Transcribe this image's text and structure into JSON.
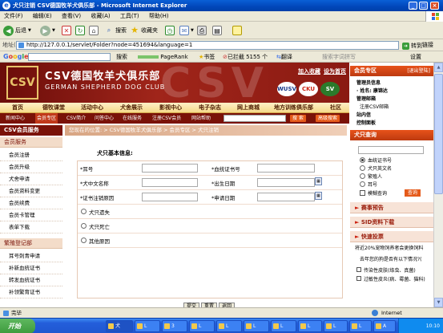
{
  "window": {
    "title": "犬只注销 CSV德国牧羊犬俱乐部 - Microsoft Internet Explorer"
  },
  "menu": [
    "文件(F)",
    "编辑(E)",
    "查看(V)",
    "收藏(A)",
    "工具(T)",
    "帮助(H)"
  ],
  "toolbar": {
    "back": "后退",
    "search": "搜索",
    "favorites": "收藏夹"
  },
  "address": {
    "label": "地址(D)",
    "url": "http://127.0.0.1/servlet/Folder?node=451694&language=1",
    "go": "转到",
    "links": "链接"
  },
  "google_bar": {
    "logo": "Google",
    "search": "搜索",
    "pagerank": "PageRank",
    "bookmarks": "书签",
    "blocked": "已拦截 5155 个",
    "translate": "翻译",
    "find_placeholder": "搜索字词拼写",
    "settings": "设置"
  },
  "site": {
    "name_cn": "CSV德国牧羊犬俱乐部",
    "name_en": "GERMAN SHEPHERD DOG CLUB",
    "watermark": "CSV",
    "logo_text": "CSV",
    "top_links": [
      "加入收藏",
      "设为首页"
    ],
    "logos": [
      "WUSV",
      "CKU",
      "SV"
    ],
    "nav": [
      "首页",
      "德牧课堂",
      "活动中心",
      "犬舍展示",
      "影视中心",
      "电子杂志",
      "网上商城",
      "地方训练俱乐部",
      "社区"
    ],
    "subnav": [
      "新闻中心",
      "会员专区",
      "CSV简介",
      "问答中心",
      "在线服务",
      "注册CSV会员",
      "网站帮助"
    ],
    "subnav_search": "搜 索",
    "subnav_advanced": "高级搜索"
  },
  "left_menu": {
    "header": "CSV会员服务",
    "section1": "会员服务",
    "items1": [
      "会员注册",
      "会员升级",
      "犬舍申请",
      "会员资料变更",
      "会员续费",
      "会员卡管理",
      "表单下载"
    ],
    "section2": "繁殖登记部",
    "items2": [
      "耳号刺青申请",
      "补新血统证书",
      "转发血统证书",
      "补领繁育证书"
    ]
  },
  "main": {
    "breadcrumb": "您现在的位置: > CSV德国牧羊犬俱乐部 > 会员专区 > 犬只注销",
    "form_title": "犬只基本信息:",
    "fields": {
      "ear_no": "*耳号",
      "pedigree_no": "*血统证书号",
      "dog_name": "*犬中文名称",
      "birth_date": "*出生日期",
      "cert_reason": "*证书注销原因",
      "apply_date": "*申请日期"
    },
    "reasons": [
      "犬只遗失",
      "犬只死亡",
      "其他原因"
    ],
    "buttons": [
      "提交",
      "重置",
      "返回"
    ]
  },
  "right_panel": {
    "member_header": "会员专区",
    "logout": "[退出登陆]",
    "member_info_label": "管理员信息",
    "member_name": "· 姓名: 康锦达",
    "manage_mail": "管理邮箱",
    "register_mail": "注册CSV邮箱",
    "inbox": "站内信",
    "control_panel": "控制面板",
    "dog_search_header": "犬只查询",
    "search_by": [
      "血统证书号",
      "犬只英文名",
      "繁殖人",
      "耳号"
    ],
    "fuzzy": "模糊查询",
    "query_button": "查询",
    "notice": "赛事预告",
    "sid_download": "SID资料下载",
    "vote_header": "快速投票",
    "vote_text": "将近20%宠物饲养者会更换饲料",
    "vote_question": "去年您的狗是否有以下情况?(",
    "vote_opts": [
      "传染性皮肤(绦虫、真菌)",
      "过敏性皮炎(病、霉菌、猫科)"
    ]
  },
  "status": {
    "text": "完毕",
    "zone": "Internet"
  },
  "taskbar": {
    "start": "开始",
    "tasks": [
      "犬",
      "L",
      "3",
      "L",
      "L",
      "L",
      "L",
      "L",
      "L",
      "L",
      "A"
    ],
    "clock": "10:10"
  }
}
